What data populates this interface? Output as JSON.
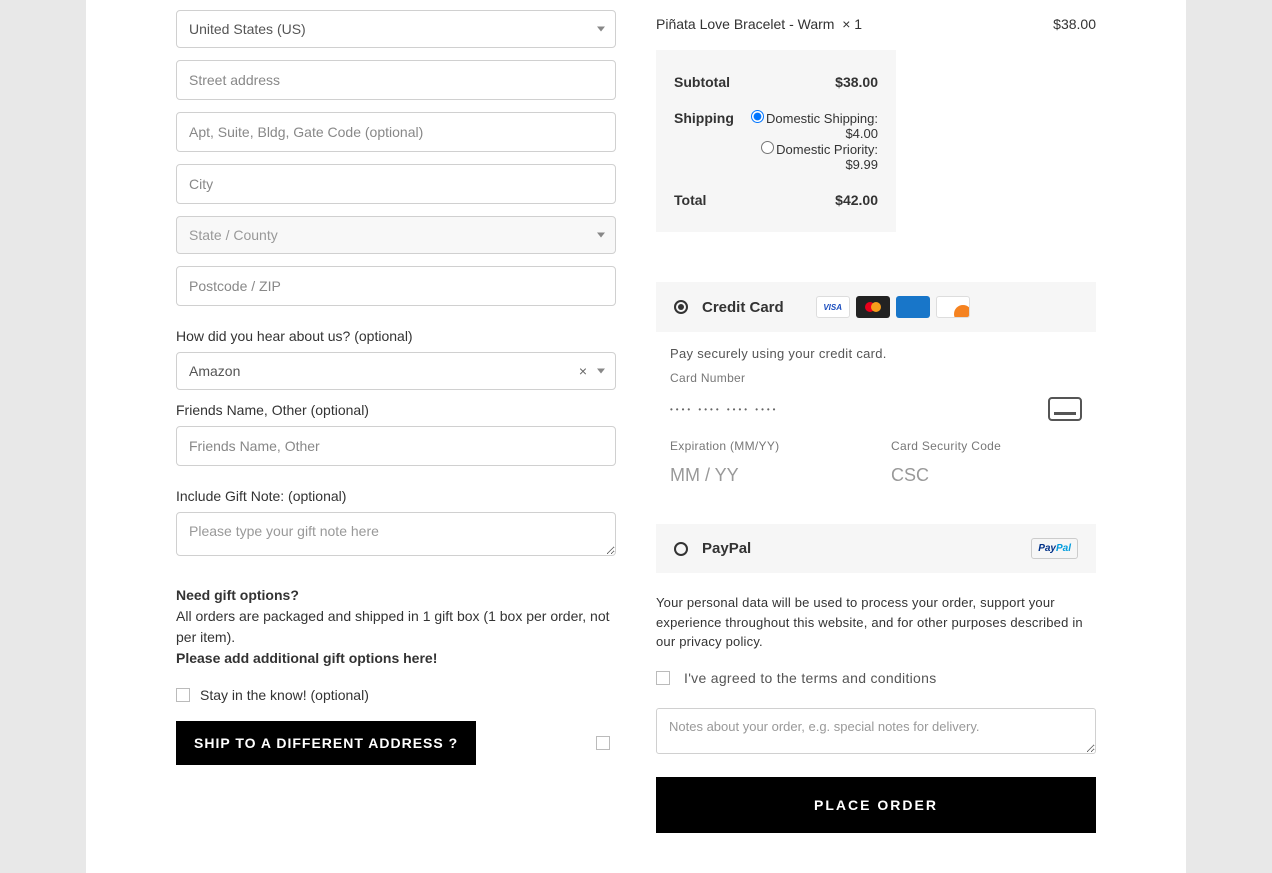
{
  "form": {
    "country": "United States (US)",
    "street_ph": "Street address",
    "apt_ph": "Apt, Suite, Bldg, Gate Code (optional)",
    "city_ph": "City",
    "state_ph": "State / County",
    "zip_ph": "Postcode / ZIP",
    "hear_label": "How did you hear about us? (optional)",
    "hear_value": "Amazon",
    "friends_label": "Friends Name, Other (optional)",
    "friends_ph": "Friends Name, Other",
    "giftnote_label": "Include Gift Note: (optional)",
    "giftnote_ph": "Please type your gift note here",
    "gift_heading": "Need gift options?",
    "gift_line": "All orders are packaged and shipped in 1 gift box (1 box per order, not per item).",
    "gift_link": "Please add additional gift options here!",
    "stay_label": "Stay in the know! (optional)",
    "ship_btn": "SHIP TO A DIFFERENT ADDRESS ?"
  },
  "cart": {
    "item_name": "Piñata Love Bracelet - Warm",
    "item_qty": "× 1",
    "item_price": "$38.00",
    "subtotal_label": "Subtotal",
    "subtotal": "$38.00",
    "shipping_label": "Shipping",
    "ship_opt1": "Domestic Shipping:",
    "ship_opt1_price": "$4.00",
    "ship_opt2": "Domestic Priority:",
    "ship_opt2_price": "$9.99",
    "total_label": "Total",
    "total": "$42.00"
  },
  "payment": {
    "cc_title": "Credit Card",
    "cc_desc": "Pay securely using your credit card.",
    "cc_num_label": "Card Number",
    "cc_dots": "•••• •••• •••• ••••",
    "cc_exp_label": "Expiration (MM/YY)",
    "cc_exp_ph": "MM / YY",
    "cc_csc_label": "Card Security Code",
    "cc_csc_ph": "CSC",
    "paypal_title": "PayPal"
  },
  "footer": {
    "privacy": "Your personal data will be used to process your order, support your experience throughout this website, and for other purposes described in our privacy policy.",
    "terms": "I've agreed to the terms and conditions",
    "notes_ph": "Notes about your order, e.g. special notes for delivery.",
    "place_btn": "PLACE ORDER"
  }
}
